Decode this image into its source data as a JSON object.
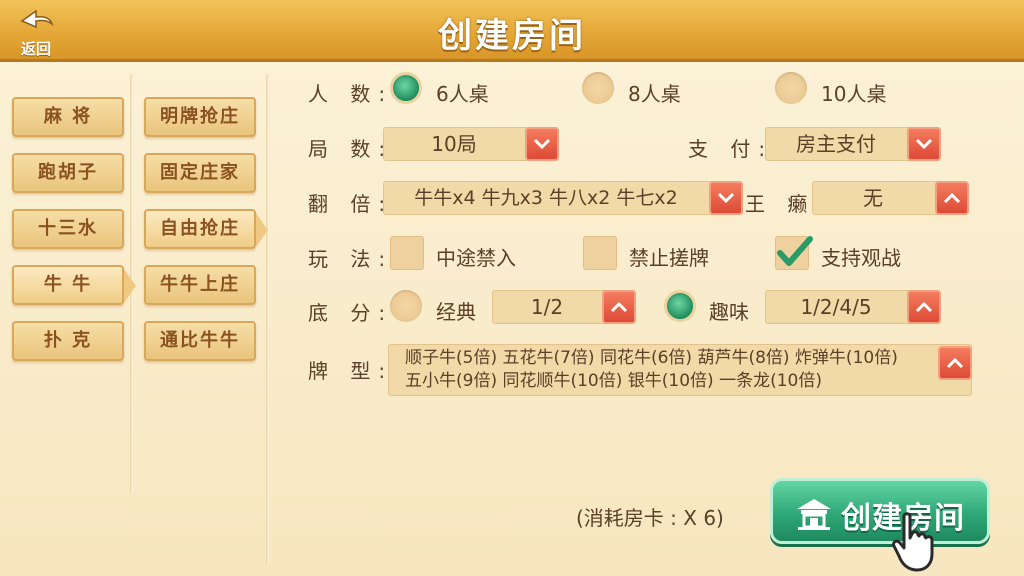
{
  "header": {
    "back_label": "返回",
    "title": "创建房间"
  },
  "game_tabs": [
    {
      "label": "麻 将",
      "active": false
    },
    {
      "label": "跑胡子",
      "active": false
    },
    {
      "label": "十三水",
      "active": false
    },
    {
      "label": "牛 牛",
      "active": true
    },
    {
      "label": "扑 克",
      "active": false
    }
  ],
  "mode_tabs": [
    {
      "label": "明牌抢庄",
      "active": false
    },
    {
      "label": "固定庄家",
      "active": false
    },
    {
      "label": "自由抢庄",
      "active": true
    },
    {
      "label": "牛牛上庄",
      "active": false
    },
    {
      "label": "通比牛牛",
      "active": false
    }
  ],
  "players": {
    "label": "人 数:",
    "options": [
      {
        "text": "6人桌",
        "selected": true
      },
      {
        "text": "8人桌",
        "selected": false
      },
      {
        "text": "10人桌",
        "selected": false
      }
    ]
  },
  "rounds": {
    "label": "局 数:",
    "value": "10局"
  },
  "payment": {
    "label": "支 付:",
    "value": "房主支付"
  },
  "multiplier": {
    "label": "翻 倍:",
    "value": "牛牛x4 牛九x3 牛八x2 牛七x2"
  },
  "wild": {
    "label": "王 癞:",
    "value": "无"
  },
  "rules": {
    "label": "玩 法:",
    "options": [
      {
        "text": "中途禁入",
        "checked": false
      },
      {
        "text": "禁止搓牌",
        "checked": false
      },
      {
        "text": "支持观战",
        "checked": true
      }
    ]
  },
  "base_score": {
    "label": "底 分:",
    "classic": {
      "text": "经典",
      "selected": false,
      "value": "1/2"
    },
    "fun": {
      "text": "趣味",
      "selected": true,
      "value": "1/2/4/5"
    }
  },
  "card_types": {
    "label": "牌 型:",
    "line1": "顺子牛(5倍) 五花牛(7倍) 同花牛(6倍) 葫芦牛(8倍) 炸弹牛(10倍)",
    "line2": "五小牛(9倍) 同花顺牛(10倍) 银牛(10倍) 一条龙(10倍)"
  },
  "cost_text": "(消耗房卡 : X 6)",
  "create_label": "创建房间",
  "colors": {
    "header": "#e3a635",
    "accent_green": "#2fa877",
    "dropdown_red": "#dd4a36",
    "background": "#f9ecca"
  },
  "icons": [
    "back-arrow-icon",
    "chevron-down-icon",
    "chevron-up-icon",
    "checkmark-icon",
    "house-icon",
    "pointing-hand-icon"
  ]
}
